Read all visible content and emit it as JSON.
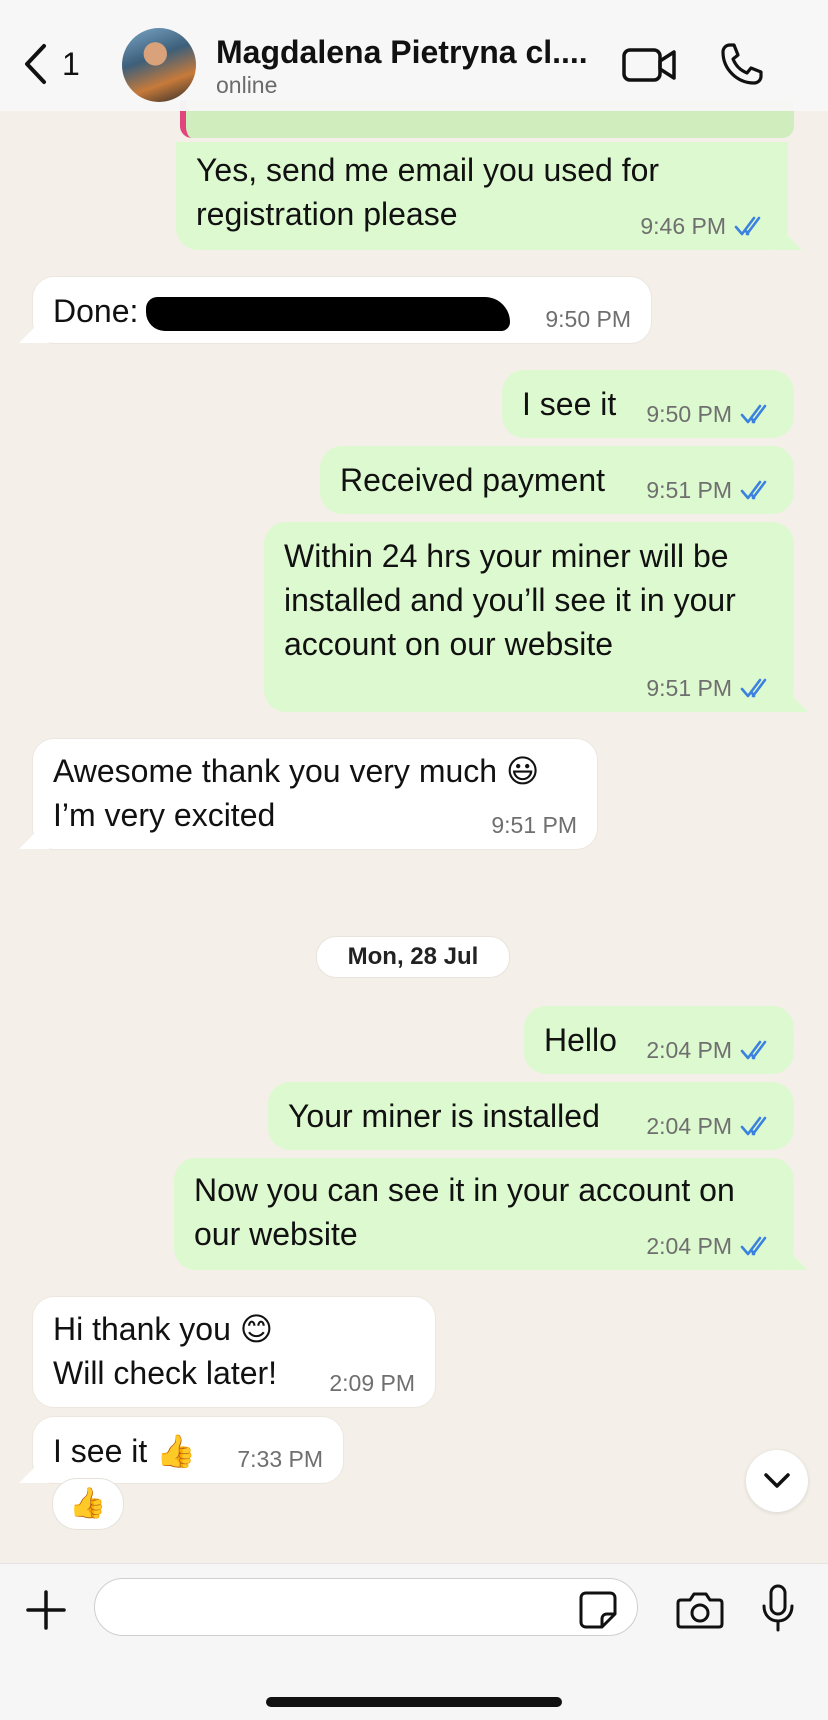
{
  "header": {
    "back_count": "1",
    "contact_name": "Magdalena Pietryna cl....",
    "status": "online"
  },
  "messages": [
    {
      "dir": "out",
      "text": "Yes, send me email you used for\nregistration please",
      "time": "9:46 PM"
    },
    {
      "dir": "in",
      "text": "Done:",
      "time": "9:50 PM",
      "redacted": true
    },
    {
      "dir": "out",
      "text": "I see it",
      "time": "9:50 PM"
    },
    {
      "dir": "out",
      "text": "Received payment",
      "time": "9:51 PM"
    },
    {
      "dir": "out",
      "text": "Within 24 hrs your miner will be\ninstalled and you’ll see it in your\naccount on our website",
      "time": "9:51 PM"
    },
    {
      "dir": "in",
      "text": "Awesome thank you very much 😃\nI’m very excited",
      "time": "9:51 PM"
    },
    {
      "dir": "out",
      "text": "Hello",
      "time": "2:04 PM"
    },
    {
      "dir": "out",
      "text": "Your miner is installed",
      "time": "2:04 PM"
    },
    {
      "dir": "out",
      "text": "Now you can see it in your account on\nour website",
      "time": "2:04 PM"
    },
    {
      "dir": "in",
      "text": "Hi thank you 😊\nWill check later!",
      "time": "2:09 PM"
    },
    {
      "dir": "in",
      "text": "I see it 👍",
      "time": "7:33 PM"
    }
  ],
  "date_separator": "Mon, 28 Jul",
  "reaction": "👍",
  "composer": {
    "placeholder": ""
  },
  "colors": {
    "outgoing_bubble": "#ddf9cf",
    "incoming_bubble": "#ffffff",
    "read_ticks": "#3b82e0"
  },
  "icons": [
    "chevron-left-icon",
    "video-camera-icon",
    "phone-icon",
    "plus-icon",
    "sticker-icon",
    "camera-icon",
    "microphone-icon",
    "chevron-down-icon",
    "double-check-icon"
  ]
}
